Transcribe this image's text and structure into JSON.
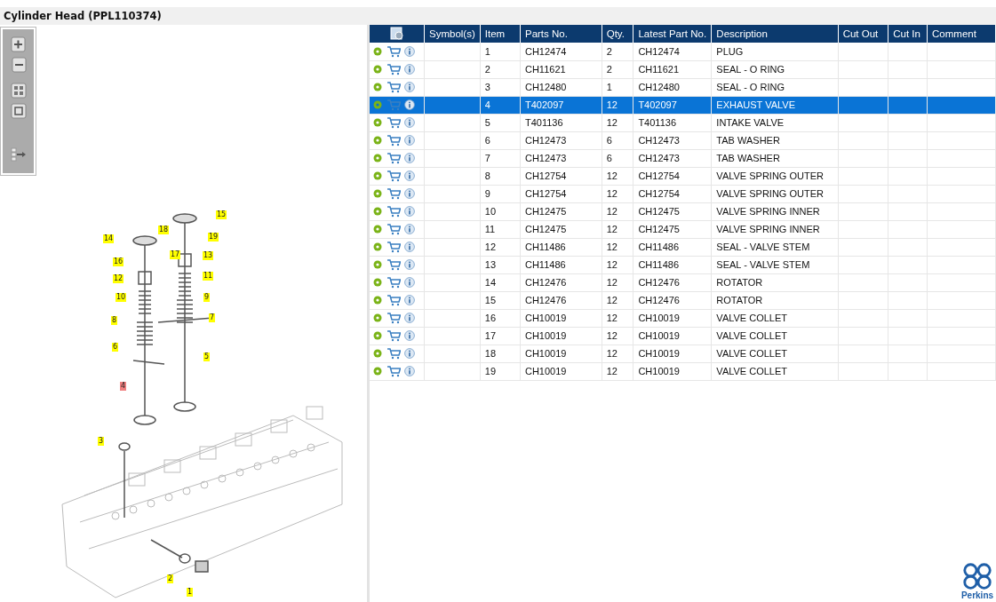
{
  "window": {
    "title": "Cylinder Head (PPL110374)"
  },
  "diagram": {
    "callouts": [
      {
        "label": "15",
        "selected": false
      },
      {
        "label": "14",
        "selected": false
      },
      {
        "label": "18",
        "selected": false
      },
      {
        "label": "19",
        "selected": false
      },
      {
        "label": "17",
        "selected": false
      },
      {
        "label": "13",
        "selected": false
      },
      {
        "label": "16",
        "selected": false
      },
      {
        "label": "12",
        "selected": false
      },
      {
        "label": "11",
        "selected": false
      },
      {
        "label": "10",
        "selected": false
      },
      {
        "label": "9",
        "selected": false
      },
      {
        "label": "8",
        "selected": false
      },
      {
        "label": "7",
        "selected": false
      },
      {
        "label": "6",
        "selected": false
      },
      {
        "label": "5",
        "selected": false
      },
      {
        "label": "4",
        "selected": true
      },
      {
        "label": "3",
        "selected": false
      },
      {
        "label": "2",
        "selected": false
      },
      {
        "label": "1",
        "selected": false
      }
    ]
  },
  "table": {
    "columns": [
      "Symbol(s)",
      "Item",
      "Parts No.",
      "Qty.",
      "Latest Part No.",
      "Description",
      "Cut Out",
      "Cut In",
      "Comment"
    ],
    "rows": [
      {
        "item": "1",
        "parts_no": "CH12474",
        "qty": "2",
        "latest_part_no": "CH12474",
        "description": "PLUG",
        "selected": false
      },
      {
        "item": "2",
        "parts_no": "CH11621",
        "qty": "2",
        "latest_part_no": "CH11621",
        "description": "SEAL - O RING",
        "selected": false
      },
      {
        "item": "3",
        "parts_no": "CH12480",
        "qty": "1",
        "latest_part_no": "CH12480",
        "description": "SEAL - O RING",
        "selected": false
      },
      {
        "item": "4",
        "parts_no": "T402097",
        "qty": "12",
        "latest_part_no": "T402097",
        "description": "EXHAUST VALVE",
        "selected": true
      },
      {
        "item": "5",
        "parts_no": "T401136",
        "qty": "12",
        "latest_part_no": "T401136",
        "description": "INTAKE VALVE",
        "selected": false
      },
      {
        "item": "6",
        "parts_no": "CH12473",
        "qty": "6",
        "latest_part_no": "CH12473",
        "description": "TAB WASHER",
        "selected": false
      },
      {
        "item": "7",
        "parts_no": "CH12473",
        "qty": "6",
        "latest_part_no": "CH12473",
        "description": "TAB WASHER",
        "selected": false
      },
      {
        "item": "8",
        "parts_no": "CH12754",
        "qty": "12",
        "latest_part_no": "CH12754",
        "description": "VALVE SPRING OUTER",
        "selected": false
      },
      {
        "item": "9",
        "parts_no": "CH12754",
        "qty": "12",
        "latest_part_no": "CH12754",
        "description": "VALVE SPRING OUTER",
        "selected": false
      },
      {
        "item": "10",
        "parts_no": "CH12475",
        "qty": "12",
        "latest_part_no": "CH12475",
        "description": "VALVE SPRING INNER",
        "selected": false
      },
      {
        "item": "11",
        "parts_no": "CH12475",
        "qty": "12",
        "latest_part_no": "CH12475",
        "description": "VALVE SPRING INNER",
        "selected": false
      },
      {
        "item": "12",
        "parts_no": "CH11486",
        "qty": "12",
        "latest_part_no": "CH11486",
        "description": "SEAL - VALVE STEM",
        "selected": false
      },
      {
        "item": "13",
        "parts_no": "CH11486",
        "qty": "12",
        "latest_part_no": "CH11486",
        "description": "SEAL - VALVE STEM",
        "selected": false
      },
      {
        "item": "14",
        "parts_no": "CH12476",
        "qty": "12",
        "latest_part_no": "CH12476",
        "description": "ROTATOR",
        "selected": false
      },
      {
        "item": "15",
        "parts_no": "CH12476",
        "qty": "12",
        "latest_part_no": "CH12476",
        "description": "ROTATOR",
        "selected": false
      },
      {
        "item": "16",
        "parts_no": "CH10019",
        "qty": "12",
        "latest_part_no": "CH10019",
        "description": "VALVE COLLET",
        "selected": false
      },
      {
        "item": "17",
        "parts_no": "CH10019",
        "qty": "12",
        "latest_part_no": "CH10019",
        "description": "VALVE COLLET",
        "selected": false
      },
      {
        "item": "18",
        "parts_no": "CH10019",
        "qty": "12",
        "latest_part_no": "CH10019",
        "description": "VALVE COLLET",
        "selected": false
      },
      {
        "item": "19",
        "parts_no": "CH10019",
        "qty": "12",
        "latest_part_no": "CH10019",
        "description": "VALVE COLLET",
        "selected": false
      }
    ]
  },
  "brand": {
    "name": "Perkins"
  }
}
